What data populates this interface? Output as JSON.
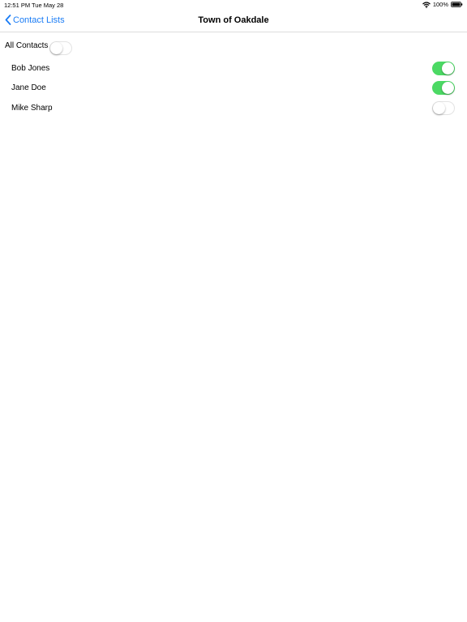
{
  "status_bar": {
    "time": "12:51 PM",
    "date": "Tue May 28",
    "battery": "100%",
    "icons": [
      "wifi-icon",
      "battery-icon"
    ]
  },
  "nav": {
    "back_label": "Contact Lists",
    "title": "Town of Oakdale"
  },
  "all_contacts": {
    "label": "All Contacts",
    "on": false
  },
  "contacts": [
    {
      "name": "Bob Jones",
      "on": true
    },
    {
      "name": "Jane Doe",
      "on": true
    },
    {
      "name": "Mike Sharp",
      "on": false
    }
  ],
  "colors": {
    "accent": "#1a7cf5",
    "toggle_on": "#4cd964"
  }
}
